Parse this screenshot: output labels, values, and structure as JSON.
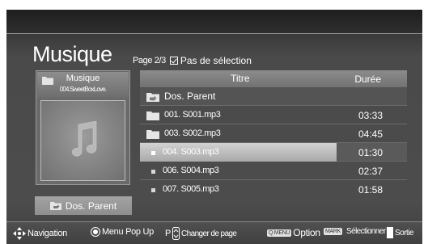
{
  "header": {
    "title": "Musique",
    "page_label": "Page 2/3",
    "selection_label": "Pas de sélection"
  },
  "info_panel": {
    "folder_name": "Musique",
    "track_name": "004.SweetBoxLove."
  },
  "parent_button": {
    "label": "Dos. Parent"
  },
  "list": {
    "col_title": "Titre",
    "col_duration": "Durée",
    "rows": [
      {
        "kind": "parent",
        "name": "Dos. Parent",
        "duration": ""
      },
      {
        "kind": "folder",
        "name": "001. S001.mp3",
        "duration": "03:33"
      },
      {
        "kind": "folder",
        "name": "003. S002.mp3",
        "duration": "04:45"
      },
      {
        "kind": "file",
        "name": "004. S003.mp3",
        "duration": "01:30",
        "selected": true
      },
      {
        "kind": "file",
        "name": "006. S004.mp3",
        "duration": "02:37"
      },
      {
        "kind": "file",
        "name": "007. S005.mp3",
        "duration": "01:58"
      }
    ]
  },
  "help_bar": {
    "navigation": "Navigation",
    "menu_popup": "Menu Pop Up",
    "page_key": "P",
    "change_page": "Changer de page",
    "qmenu_key": "Q.MENU",
    "option": "Option",
    "mark_key": "MARK",
    "select": "Sélectionner",
    "exit": "Sortie"
  }
}
